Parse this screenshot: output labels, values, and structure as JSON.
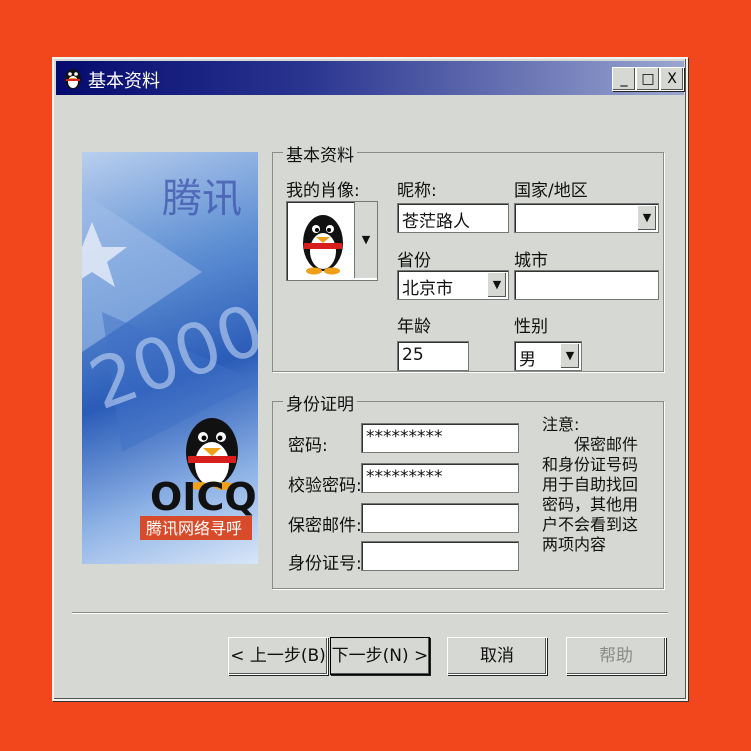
{
  "window": {
    "title": "基本资料",
    "controls": [
      "_",
      "□",
      "X"
    ]
  },
  "banner": {
    "brand": "OICQ",
    "slogan": "腾讯网络寻呼",
    "heading": "腾讯",
    "year": "2000"
  },
  "basic_info": {
    "group_label": "基本资料",
    "avatar_label": "我的肖像:",
    "nickname_label": "昵称:",
    "nickname_value": "苍茫路人",
    "country_label": "国家/地区",
    "country_value": "",
    "province_label": "省份",
    "province_value": "北京市",
    "city_label": "城市",
    "city_value": "",
    "age_label": "年龄",
    "age_value": "25",
    "gender_label": "性别",
    "gender_value": "男"
  },
  "identity": {
    "group_label": "身份证明",
    "password_label": "密码:",
    "password_value": "*********",
    "confirm_label": "校验密码:",
    "confirm_value": "*********",
    "email_label": "保密邮件:",
    "email_value": "",
    "id_label": "身份证号:",
    "id_value": "",
    "note_title": "注意:",
    "note_body": "保密邮件和身份证号码用于自助找回密码，其他用户不会看到这两项内容"
  },
  "buttons": {
    "prev": "< 上一步(B)",
    "next": "下一步(N) >",
    "cancel": "取消",
    "help": "帮助"
  }
}
